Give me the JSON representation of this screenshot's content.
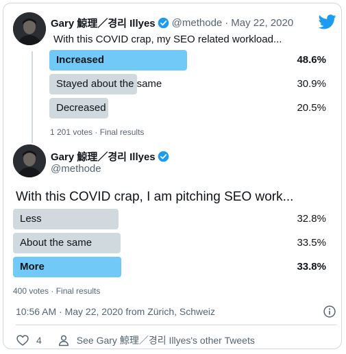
{
  "quoted_tweet": {
    "display_name": "Gary 鯨理／경리 Illyes",
    "handle": "@methode",
    "separator": "·",
    "date": "May 22, 2020",
    "text": "With this COVID crap, my SEO related workload...",
    "poll": {
      "options": [
        {
          "label": "Increased",
          "percent": "48.6%",
          "share": 0.486,
          "winner": true
        },
        {
          "label": "Stayed about the same",
          "percent": "30.9%",
          "share": 0.309,
          "winner": false
        },
        {
          "label": "Decreased",
          "percent": "20.5%",
          "share": 0.205,
          "winner": false
        }
      ],
      "meta": "1 201 votes · Final results"
    }
  },
  "main_tweet": {
    "display_name": "Gary 鯨理／경리 Illyes",
    "handle": "@methode",
    "text": "With this COVID crap, I am pitching SEO work...",
    "poll": {
      "options": [
        {
          "label": "Less",
          "percent": "32.8%",
          "share": 0.328,
          "winner": false
        },
        {
          "label": "About the same",
          "percent": "33.5%",
          "share": 0.335,
          "winner": false
        },
        {
          "label": "More",
          "percent": "33.8%",
          "share": 0.338,
          "winner": true
        }
      ],
      "meta": "400 votes · Final results"
    },
    "timestamp": "10:56 AM · May 22, 2020 from Zürich, Schweiz",
    "like_count": "4",
    "profile_link": "See Gary 鯨理／경리 Illyes's other Tweets"
  },
  "icons": {
    "logo": "twitter-bird-icon",
    "verified": "verified-badge-icon",
    "info": "info-icon",
    "like": "heart-icon",
    "profile": "person-icon"
  },
  "colors": {
    "accent": "#1d9bf0",
    "winner_bar": "#71c9f8",
    "loser_bar": "#cfd9de",
    "secondary_text": "#536471"
  }
}
